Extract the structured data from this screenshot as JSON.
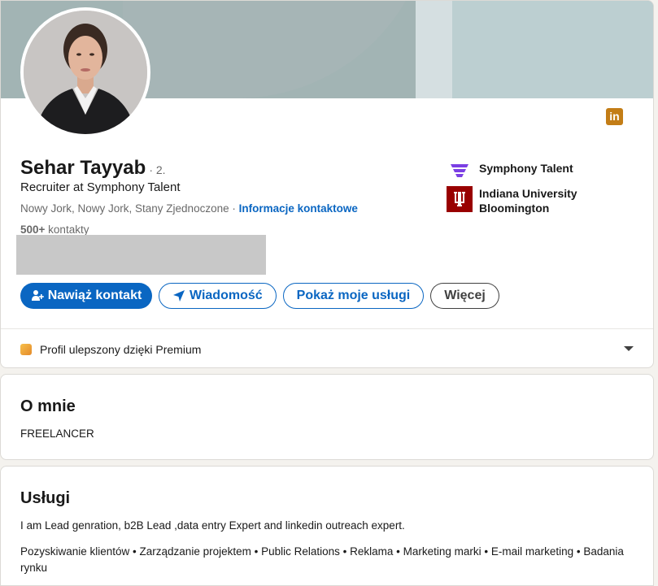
{
  "profile": {
    "name": "Sehar Tayyab",
    "degree": "· 2.",
    "headline": "Recruiter at Symphony Talent",
    "location": "Nowy Jork, Nowy Jork, Stany Zjednoczone",
    "separator": " · ",
    "contact_info_label": "Informacje kontaktowe",
    "connections_count": "500+",
    "connections_label": " kontakty"
  },
  "organizations": [
    {
      "name": "Symphony Talent",
      "icon": "symphony-talent-logo"
    },
    {
      "name": "Indiana University Bloomington",
      "icon": "indiana-university-logo"
    }
  ],
  "actions": {
    "connect": "Nawiąż kontakt",
    "message": "Wiadomość",
    "services": "Pokaż moje usługi",
    "more": "Więcej"
  },
  "premium": {
    "label": "Profil ulepszony dzięki Premium"
  },
  "about": {
    "title": "O mnie",
    "text": "FREELANCER"
  },
  "services": {
    "title": "Usługi",
    "description": "I am Lead genration, b2B Lead ,data entry Expert and linkedin outreach expert.",
    "skills": "Pozyskiwanie klientów • Zarządzanie projektem • Public Relations • Reklama • Marketing marki • E-mail marketing • Badania rynku"
  },
  "colors": {
    "accent": "#0a66c2",
    "premium": "#e48a2a",
    "linkedin_badge": "#c37d16",
    "iu_crimson": "#990000",
    "symphony_purple": "#7b3fe4"
  }
}
